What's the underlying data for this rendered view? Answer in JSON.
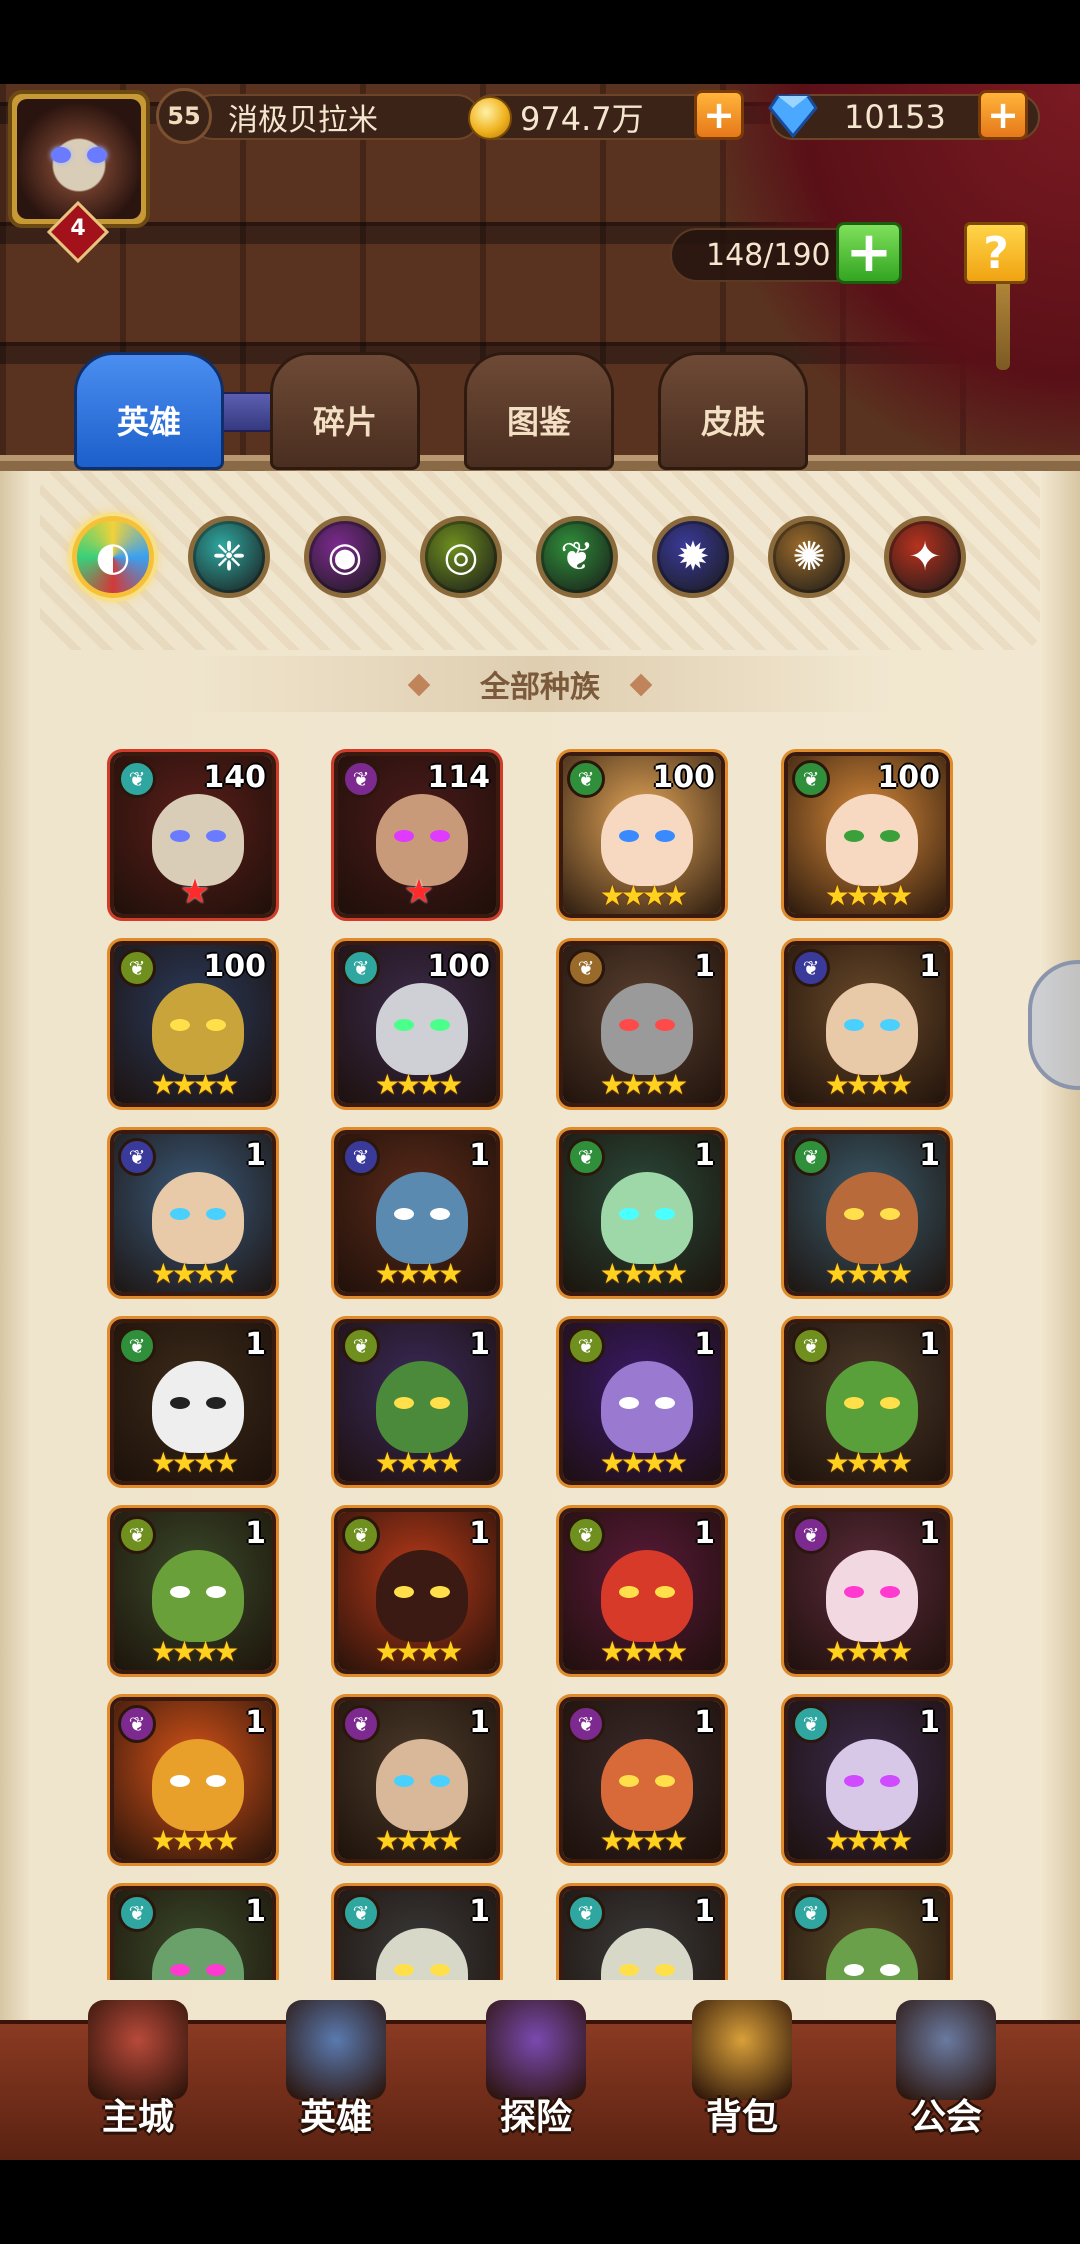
{
  "player": {
    "level": "55",
    "name": "消极贝拉米",
    "vip_level": "4",
    "gold": "974.7万",
    "diamonds": "10153"
  },
  "hero_capacity": "148/190",
  "help_label": "?",
  "tabs": [
    {
      "label": "英雄",
      "active": true
    },
    {
      "label": "碎片",
      "active": false
    },
    {
      "label": "图鉴",
      "active": false
    },
    {
      "label": "皮肤",
      "active": false
    }
  ],
  "race_filters": [
    {
      "name": "all",
      "color": "#f06a3a"
    },
    {
      "name": "race-1",
      "color": "#2fa7a0"
    },
    {
      "name": "race-2",
      "color": "#7c2a8f"
    },
    {
      "name": "race-3",
      "color": "#6f8f1f"
    },
    {
      "name": "race-4",
      "color": "#2f8f3a"
    },
    {
      "name": "race-5",
      "color": "#3a3a9a"
    },
    {
      "name": "race-6",
      "color": "#9a6a2a"
    },
    {
      "name": "race-7",
      "color": "#b8321e"
    }
  ],
  "race_filter_title": "全部种族",
  "heroes": [
    {
      "level": "140",
      "stars": "★",
      "red": true,
      "race": "#2fa7a0",
      "bg": "#5a1e1a",
      "face": "#d9cdb8",
      "eye": "#6b7bff"
    },
    {
      "level": "114",
      "stars": "★",
      "red": true,
      "race": "#7c2a8f",
      "bg": "#4a1a1a",
      "face": "#c99a7a",
      "eye": "#e03aff"
    },
    {
      "level": "100",
      "stars": "★★★★",
      "red": false,
      "race": "#2f8f3a",
      "bg": "#e6a85a",
      "face": "#f7d9c2",
      "eye": "#3a8aff"
    },
    {
      "level": "100",
      "stars": "★★★★",
      "red": false,
      "race": "#2f8f3a",
      "bg": "#d88a3a",
      "face": "#f7d9c2",
      "eye": "#3aa03a"
    },
    {
      "level": "100",
      "stars": "★★★★",
      "red": false,
      "race": "#6f8f1f",
      "bg": "#2a3a5a",
      "face": "#c9a43a",
      "eye": "#ffe04a"
    },
    {
      "level": "100",
      "stars": "★★★★",
      "red": false,
      "race": "#2fa7a0",
      "bg": "#3a2a4a",
      "face": "#cfcfd6",
      "eye": "#4aff8a"
    },
    {
      "level": "1",
      "stars": "★★★★",
      "red": false,
      "race": "#9a6a2a",
      "bg": "#5a4030",
      "face": "#9a9a9a",
      "eye": "#ff4a4a"
    },
    {
      "level": "1",
      "stars": "★★★★",
      "red": false,
      "race": "#3a3a9a",
      "bg": "#6a4a2a",
      "face": "#e8c9a8",
      "eye": "#4ad0ff"
    },
    {
      "level": "1",
      "stars": "★★★★",
      "red": false,
      "race": "#3a3a9a",
      "bg": "#3a5a7a",
      "face": "#e8c9a8",
      "eye": "#4ad0ff"
    },
    {
      "level": "1",
      "stars": "★★★★",
      "red": false,
      "race": "#3a3a9a",
      "bg": "#5a2a1a",
      "face": "#5a8ab0",
      "eye": "#ffffff"
    },
    {
      "level": "1",
      "stars": "★★★★",
      "red": false,
      "race": "#2f8f3a",
      "bg": "#2a4a3a",
      "face": "#9fd8a8",
      "eye": "#4affff"
    },
    {
      "level": "1",
      "stars": "★★★★",
      "red": false,
      "race": "#2f8f3a",
      "bg": "#3a5a6a",
      "face": "#b86a3a",
      "eye": "#ffe04a"
    },
    {
      "level": "1",
      "stars": "★★★★",
      "red": false,
      "race": "#2f8f3a",
      "bg": "#3a2a1a",
      "face": "#eeeeee",
      "eye": "#222222"
    },
    {
      "level": "1",
      "stars": "★★★★",
      "red": false,
      "race": "#6f8f1f",
      "bg": "#3a2a5a",
      "face": "#4a8a3a",
      "eye": "#ffe04a"
    },
    {
      "level": "1",
      "stars": "★★★★",
      "red": false,
      "race": "#6f8f1f",
      "bg": "#3a1a6a",
      "face": "#9a7ad0",
      "eye": "#ffffff"
    },
    {
      "level": "1",
      "stars": "★★★★",
      "red": false,
      "race": "#6f8f1f",
      "bg": "#4a3a2a",
      "face": "#5aa03a",
      "eye": "#ffe04a"
    },
    {
      "level": "1",
      "stars": "★★★★",
      "red": false,
      "race": "#6f8f1f",
      "bg": "#3a4a2a",
      "face": "#6aa03a",
      "eye": "#ffffff"
    },
    {
      "level": "1",
      "stars": "★★★★",
      "red": false,
      "race": "#6f8f1f",
      "bg": "#b83a1a",
      "face": "#3a1a12",
      "eye": "#ffe04a"
    },
    {
      "level": "1",
      "stars": "★★★★",
      "red": false,
      "race": "#6f8f1f",
      "bg": "#5a1a3a",
      "face": "#d83a2a",
      "eye": "#ffe04a"
    },
    {
      "level": "1",
      "stars": "★★★★",
      "red": false,
      "race": "#7c2a8f",
      "bg": "#5a2a3a",
      "face": "#f2d8e0",
      "eye": "#ff3ad0"
    },
    {
      "level": "1",
      "stars": "★★★★",
      "red": false,
      "race": "#7c2a8f",
      "bg": "#d8541a",
      "face": "#e8a02a",
      "eye": "#ffffff"
    },
    {
      "level": "1",
      "stars": "★★★★",
      "red": false,
      "race": "#7c2a8f",
      "bg": "#4a3a2a",
      "face": "#d8b898",
      "eye": "#4ad0ff"
    },
    {
      "level": "1",
      "stars": "★★★★",
      "red": false,
      "race": "#7c2a8f",
      "bg": "#3a2a2a",
      "face": "#d86a3a",
      "eye": "#ffe04a"
    },
    {
      "level": "1",
      "stars": "★★★★",
      "red": false,
      "race": "#2fa7a0",
      "bg": "#3a2a4a",
      "face": "#d8c8e8",
      "eye": "#d04aff"
    },
    {
      "level": "1",
      "stars": "★★★★",
      "red": false,
      "race": "#2fa7a0",
      "bg": "#3a4a2a",
      "face": "#6aa06a",
      "eye": "#ff3ad0"
    },
    {
      "level": "1",
      "stars": "★★★★",
      "red": false,
      "race": "#2fa7a0",
      "bg": "#3a3a3a",
      "face": "#d8d8c8",
      "eye": "#ffe04a"
    },
    {
      "level": "1",
      "stars": "★★★★",
      "red": false,
      "race": "#2fa7a0",
      "bg": "#3a3a3a",
      "face": "#d8d8c8",
      "eye": "#ffe04a"
    },
    {
      "level": "1",
      "stars": "★★★★",
      "red": false,
      "race": "#2fa7a0",
      "bg": "#5a4a2a",
      "face": "#6aa04a",
      "eye": "#ffffff"
    }
  ],
  "bottom_nav": [
    {
      "label": "主城",
      "icon": "castle-icon",
      "color": "#b84a3a"
    },
    {
      "label": "英雄",
      "icon": "hero-portrait-icon",
      "color": "#5a7ab0"
    },
    {
      "label": "探险",
      "icon": "portal-icon",
      "color": "#7a4ab0"
    },
    {
      "label": "背包",
      "icon": "backpack-icon",
      "color": "#d8a03a"
    },
    {
      "label": "公会",
      "icon": "guild-tower-icon",
      "color": "#6a7aa0"
    }
  ]
}
